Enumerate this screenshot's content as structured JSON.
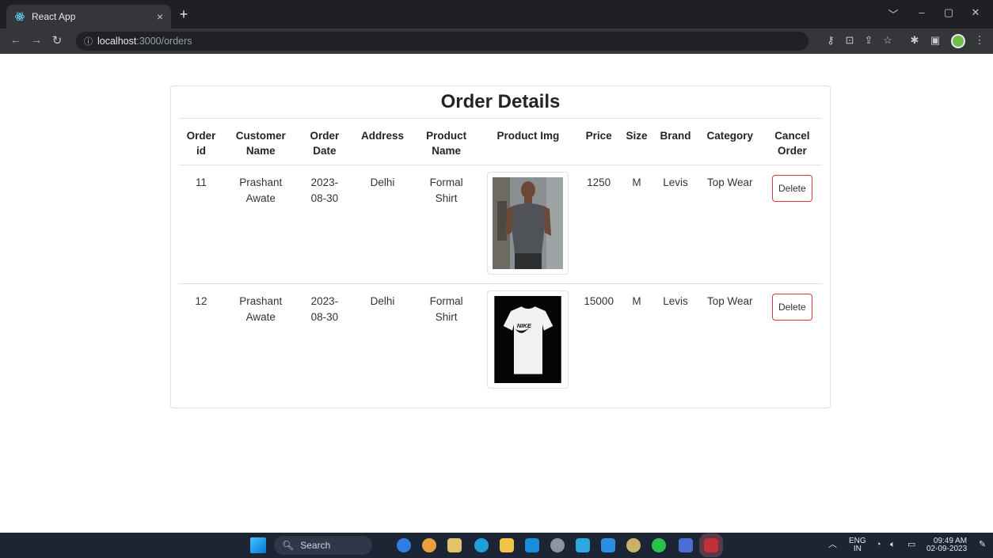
{
  "browser": {
    "tab_title": "React App",
    "tab_close": "×",
    "new_tab": "+",
    "url_host": "localhost",
    "url_path": ":3000/orders",
    "window_controls": [
      "﹀",
      "–",
      "▢",
      "✕"
    ],
    "nav_icons": [
      "back-arrow-icon",
      "forward-arrow-icon",
      "reload-icon"
    ],
    "toolbar_icons": [
      "key-icon",
      "install-icon",
      "share-icon",
      "star-icon",
      "extensions-icon",
      "sidebar-icon"
    ]
  },
  "page": {
    "title": "Order Details",
    "columns": [
      [
        "Order",
        "id"
      ],
      [
        "Customer",
        "Name"
      ],
      [
        "Order",
        "Date"
      ],
      [
        "Address"
      ],
      [
        "Product",
        "Name"
      ],
      [
        "Product Img"
      ],
      [
        "Price"
      ],
      [
        "Size"
      ],
      [
        "Brand"
      ],
      [
        "Category"
      ],
      [
        "Cancel",
        "Order"
      ]
    ],
    "orders": [
      {
        "id": "11",
        "customer": [
          "Prashant",
          "Awate"
        ],
        "date": [
          "2023-",
          "08-30"
        ],
        "address": "Delhi",
        "product": [
          "Formal",
          "Shirt"
        ],
        "image": "tank-top-model-photo",
        "price": "1250",
        "size": "M",
        "brand": "Levis",
        "category": "Top Wear",
        "action": "Delete"
      },
      {
        "id": "12",
        "customer": [
          "Prashant",
          "Awate"
        ],
        "date": [
          "2023-",
          "08-30"
        ],
        "address": "Delhi",
        "product": [
          "Formal",
          "Shirt"
        ],
        "image": "white-nike-tshirt-photo",
        "price": "15000",
        "size": "M",
        "brand": "Levis",
        "category": "Top Wear",
        "action": "Delete"
      }
    ]
  },
  "taskbar": {
    "search_placeholder": "Search",
    "lang": [
      "ENG",
      "IN"
    ],
    "time": "09:49 AM",
    "date": "02-09-2023"
  },
  "colors": {
    "delete_border": "#dc3545",
    "taskbar": "#1c2533",
    "chrome_dark": "#35363a"
  }
}
